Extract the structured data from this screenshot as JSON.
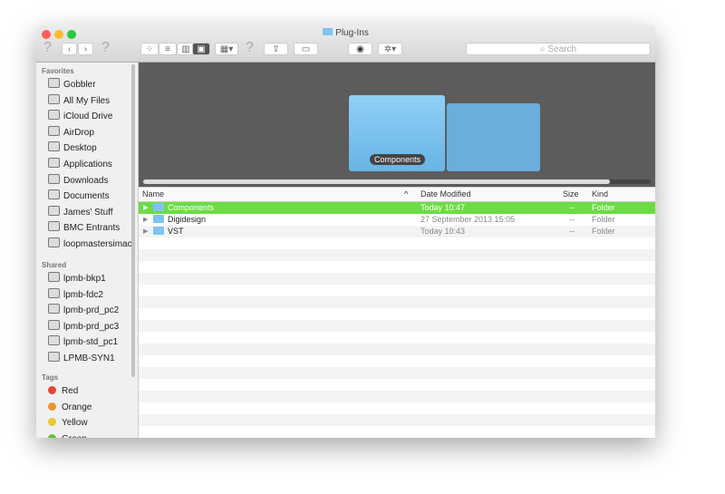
{
  "window": {
    "title": "Plug-Ins"
  },
  "toolbar": {
    "search_placeholder": "Search",
    "back": "‹",
    "forward": "›",
    "help": "?"
  },
  "sidebar": {
    "favorites_label": "Favorites",
    "favorites": [
      "Gobbler",
      "All My Files",
      "iCloud Drive",
      "AirDrop",
      "Desktop",
      "Applications",
      "Downloads",
      "Documents",
      "James' Stuff",
      "BMC Entrants",
      "loopmastersimac"
    ],
    "shared_label": "Shared",
    "shared": [
      "lpmb-bkp1",
      "lpmb-fdc2",
      "lpmb-prd_pc2",
      "lpmb-prd_pc3",
      "lpmb-std_pc1",
      "LPMB-SYN1"
    ],
    "tags_label": "Tags",
    "tags": [
      {
        "label": "Red",
        "color": "#e8443a"
      },
      {
        "label": "Orange",
        "color": "#f0932e"
      },
      {
        "label": "Yellow",
        "color": "#e8c830"
      },
      {
        "label": "Green",
        "color": "#5ac23a"
      }
    ]
  },
  "coverflow": {
    "selected_label": "Components"
  },
  "list": {
    "columns": {
      "name": "Name",
      "date": "Date Modified",
      "size": "Size",
      "kind": "Kind"
    },
    "rows": [
      {
        "name": "Components",
        "date": "Today 10:47",
        "size": "--",
        "kind": "Folder",
        "selected": true
      },
      {
        "name": "Digidesign",
        "date": "27 September 2013 15:05",
        "size": "--",
        "kind": "Folder"
      },
      {
        "name": "VST",
        "date": "Today 10:43",
        "size": "--",
        "kind": "Folder"
      }
    ]
  },
  "colors": {
    "selection": "#6cdc44"
  }
}
